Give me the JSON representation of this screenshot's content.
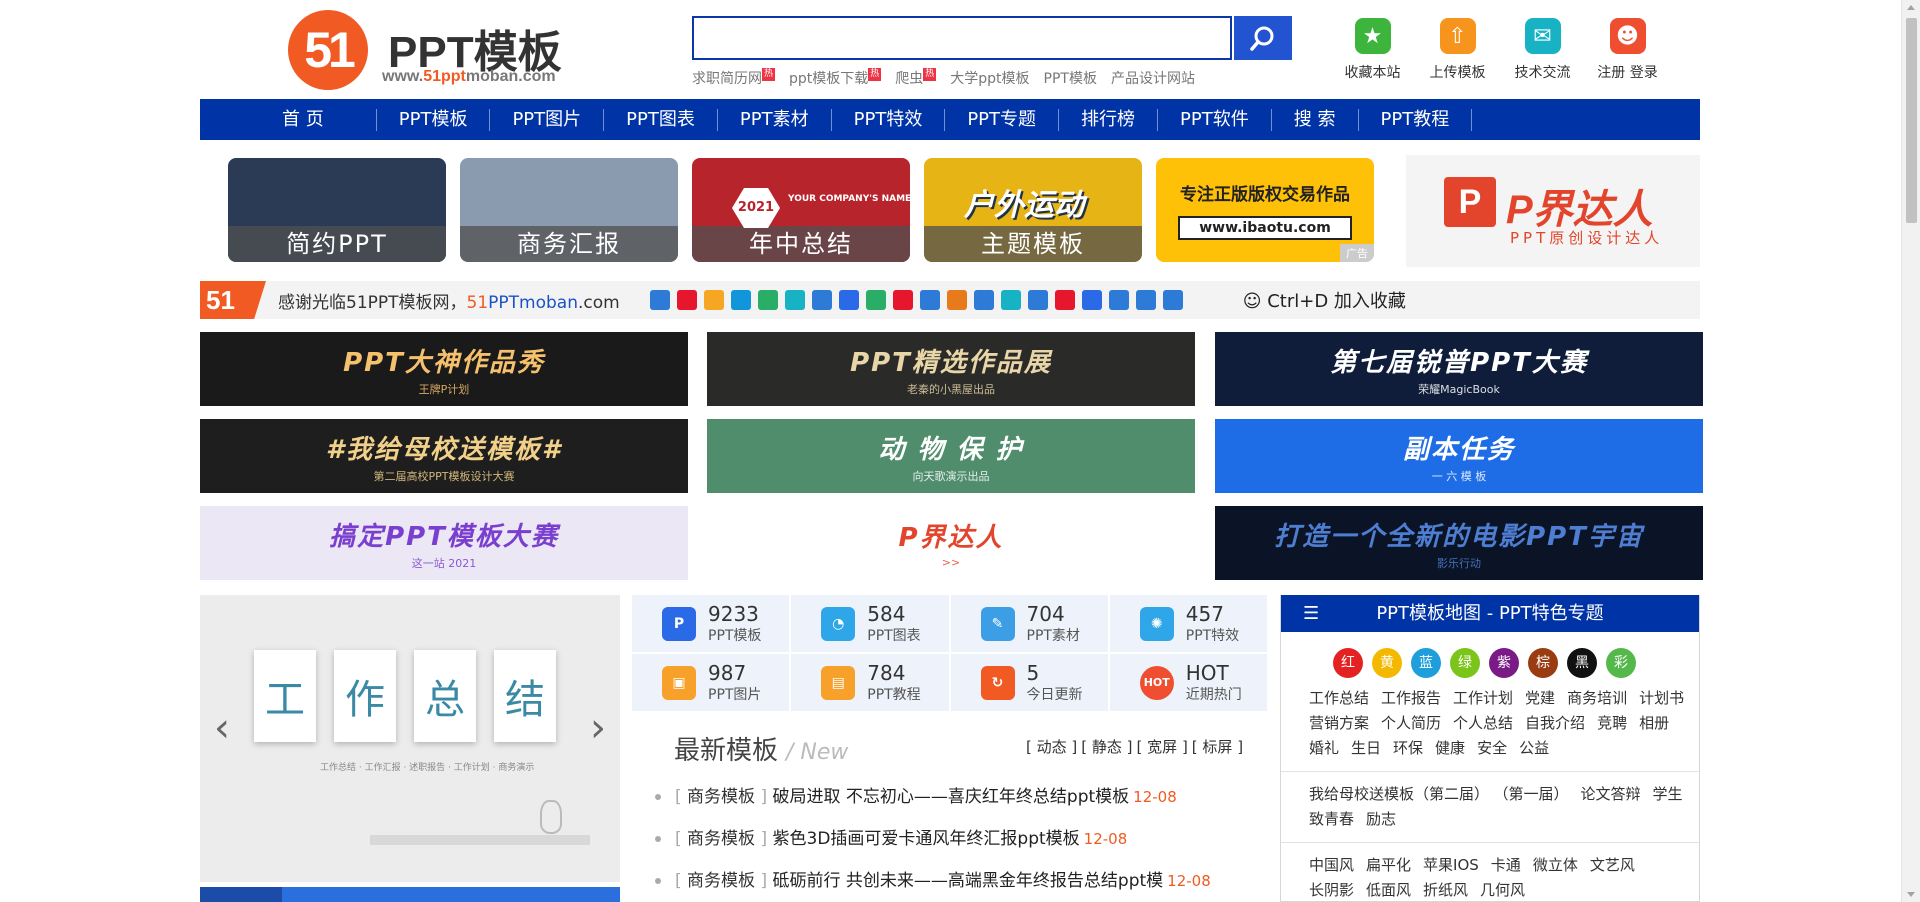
{
  "logo": {
    "mark": "51",
    "title": "PPT模板",
    "url_prefix": "www.",
    "url_brand": "51ppt",
    "url_suffix": "moban.com"
  },
  "search": {
    "value": "",
    "placeholder": ""
  },
  "hotwords": [
    {
      "text": "求职简历网",
      "hot": true
    },
    {
      "text": "ppt模板下载",
      "hot": true
    },
    {
      "text": "爬虫",
      "hot": true
    },
    {
      "text": "大学ppt模板",
      "hot": false
    },
    {
      "text": "PPT模板",
      "hot": false
    },
    {
      "text": "产品设计网站",
      "hot": false
    }
  ],
  "hot_badge": "热",
  "quick": [
    {
      "label": "收藏本站",
      "icon": "star-icon",
      "color": "#3db53d"
    },
    {
      "label": "上传模板",
      "icon": "upload-icon",
      "color": "#f7941d"
    },
    {
      "label": "技术交流",
      "icon": "chat-icon",
      "color": "#17b3c5"
    },
    {
      "label": "注册 登录",
      "icon": "user-icon",
      "color": "#f04e31"
    }
  ],
  "nav": [
    "首 页",
    "PPT模板",
    "PPT图片",
    "PPT图表",
    "PPT素材",
    "PPT特效",
    "PPT专题",
    "排行榜",
    "PPT软件",
    "搜 索",
    "PPT教程"
  ],
  "tiles": [
    {
      "label": "简约PPT",
      "bg": "#2b3a55"
    },
    {
      "label": "商务汇报",
      "bg": "#8a9bb0"
    },
    {
      "label": "年中总结",
      "bg": "#b8242c",
      "year": "2021",
      "line1": "YOUR COMPANY'S NAME"
    },
    {
      "label": "主题模板",
      "bg": "#e7b416",
      "art": "户外运动"
    },
    {
      "label": "",
      "bg": "#ffc107",
      "title": "专注正版版权交易作品",
      "url": "www.ibaotu.com",
      "ad": "广告"
    }
  ],
  "pjdr_side": {
    "title": "P界达人",
    "subtitle": "PPT原创设计达人"
  },
  "thanks": {
    "mark": "51",
    "text": "感谢光临51PPT模板网，",
    "brand_a": "51",
    "brand_b": "PPTmoban",
    "brand_c": ".com",
    "fav": "Ctrl+D 加入收藏"
  },
  "shares_colors": [
    "#2d7bd6",
    "#e6162d",
    "#f5a623",
    "#1296db",
    "#2aae67",
    "#17b3c5",
    "#2d7bd6",
    "#2b6ae6",
    "#2aae67",
    "#e6162d",
    "#2d7bd6",
    "#e77a1a",
    "#2d7bd6",
    "#17b3c5",
    "#2d7bd6",
    "#e6162d",
    "#2b6ae6",
    "#2d7bd6",
    "#2d7bd6",
    "#2d7bd6"
  ],
  "banners": [
    {
      "text": "PPT大神作品秀",
      "sub": "王牌P计划",
      "bg": "#1a1a1a",
      "fg": "#f5c16c"
    },
    {
      "text": "PPT精选作品展",
      "sub": "老秦的小黑屋出品",
      "bg": "#2a2a28",
      "fg": "#e8d6a8"
    },
    {
      "text": "第七届锐普PPT大赛",
      "sub": "荣耀MagicBook",
      "bg": "#0f1d3a",
      "fg": "#ffffff"
    },
    {
      "text": "#我给母校送模板#",
      "sub": "第二届高校PPT模板设计大赛",
      "bg": "#1e1e1e",
      "fg": "#f1d08a"
    },
    {
      "text": "动 物 保 护",
      "sub": "向天歌演示出品",
      "bg": "#4f8d6d",
      "fg": "#ffffff"
    },
    {
      "text": "副本任务",
      "sub": "一 六 模 板",
      "bg": "#1e6de6",
      "fg": "#ffffff"
    },
    {
      "text": "搞定PPT模板大赛",
      "sub": "这一站 2021",
      "bg": "#ece7f5",
      "fg": "#7a3fcf"
    },
    {
      "text": "P界达人",
      "sub": ">>",
      "bg": "#ffffff",
      "fg": "#e2452b"
    },
    {
      "text": "打造一个全新的电影PPT宇宙",
      "sub": "影乐行动",
      "bg": "#0b1426",
      "fg": "#4e7ed1"
    }
  ],
  "slider": {
    "chars": [
      "工",
      "作",
      "总",
      "结"
    ],
    "prev": "‹",
    "next": "›",
    "caption": "工作总结 · 工作汇报 · 述职报告 · 工作计划 · 商务演示"
  },
  "stats": [
    {
      "num": "9233",
      "cat": "PPT模板",
      "icon": "ppt-icon",
      "color": "#2b6ae6"
    },
    {
      "num": "584",
      "cat": "PPT图表",
      "icon": "pie-chart-icon",
      "color": "#2fa6e8"
    },
    {
      "num": "704",
      "cat": "PPT素材",
      "icon": "material-icon",
      "color": "#3c9ee5"
    },
    {
      "num": "457",
      "cat": "PPT特效",
      "icon": "effect-icon",
      "color": "#2fa6e8"
    },
    {
      "num": "987",
      "cat": "PPT图片",
      "icon": "image-icon",
      "color": "#f7a12a"
    },
    {
      "num": "784",
      "cat": "PPT教程",
      "icon": "tutorial-icon",
      "color": "#f7a12a"
    },
    {
      "num": "5",
      "cat": "今日更新",
      "icon": "refresh-icon",
      "color": "#f15a22"
    },
    {
      "num": "HOT",
      "cat": "近期热门",
      "icon": "hot-icon",
      "color": "#f04e31"
    }
  ],
  "latest": {
    "title": "最新模板",
    "title_en": "New",
    "filters": [
      "动态",
      "静态",
      "宽屏",
      "标屏"
    ],
    "items": [
      {
        "cat": "商务模板",
        "title": "破局进取 不忘初心——喜庆红年终总结ppt模板",
        "date": "12-08"
      },
      {
        "cat": "商务模板",
        "title": "紫色3D插画可爱卡通风年终汇报ppt模板",
        "date": "12-08"
      },
      {
        "cat": "商务模板",
        "title": "砥砺前行 共创未来——高端黑金年终报告总结ppt模",
        "date": "12-08"
      }
    ]
  },
  "map": {
    "title": "PPT模板地图 - PPT特色专题",
    "colors": [
      {
        "t": "红",
        "c": "#e42222"
      },
      {
        "t": "黄",
        "c": "#f5b800"
      },
      {
        "t": "蓝",
        "c": "#1e9fdc"
      },
      {
        "t": "绿",
        "c": "#7bc41a"
      },
      {
        "t": "紫",
        "c": "#7a1a86"
      },
      {
        "t": "棕",
        "c": "#9a3c12"
      },
      {
        "t": "黑",
        "c": "#111111"
      },
      {
        "t": "彩",
        "c": "#55b84a"
      }
    ],
    "group1": [
      "工作总结",
      "工作报告",
      "工作计划",
      "党建",
      "商务培训",
      "计划书",
      "营销方案",
      "个人简历",
      "个人总结",
      "自我介绍",
      "竞聘",
      "相册",
      "婚礼",
      "生日",
      "环保",
      "健康",
      "安全",
      "公益"
    ],
    "group2": [
      "我给母校送模板（第二届）",
      "（第一届）",
      "论文答辩",
      "学生",
      "致青春",
      "励志"
    ],
    "group3": [
      "中国风",
      "扁平化",
      "苹果IOS",
      "卡通",
      "微立体",
      "文艺风",
      "长阴影",
      "低面风",
      "折纸风",
      "几何风"
    ]
  }
}
